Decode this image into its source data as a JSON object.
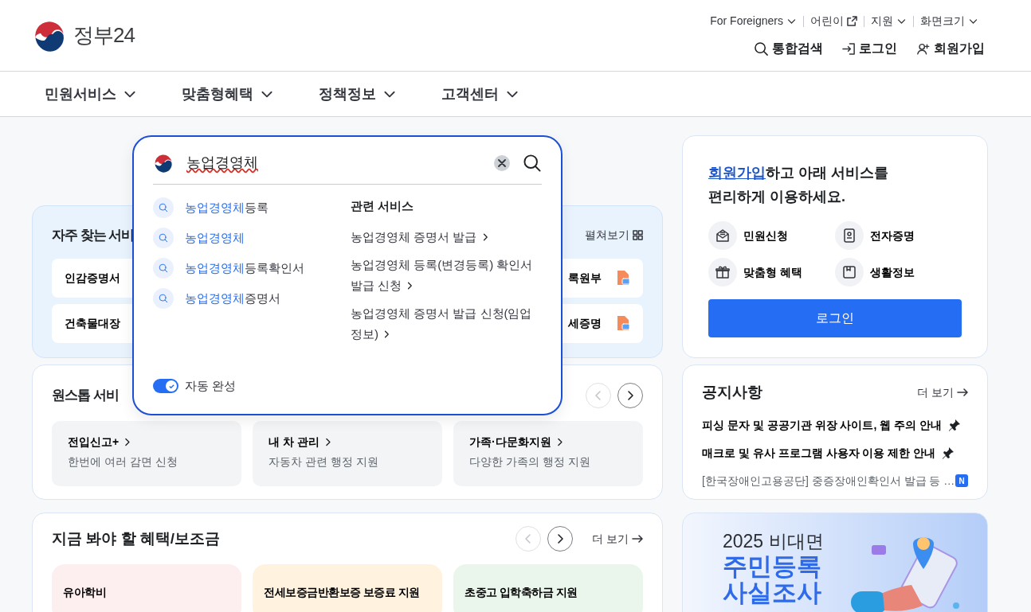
{
  "header": {
    "logo_text": "정부24",
    "top_links": [
      {
        "label": "For Foreigners",
        "kind": "chevron"
      },
      {
        "label": "어린이",
        "kind": "external"
      },
      {
        "label": "지원",
        "kind": "chevron"
      },
      {
        "label": "화면크기",
        "kind": "chevron"
      }
    ],
    "actions": [
      {
        "label": "통합검색",
        "kind": "search"
      },
      {
        "label": "로그인",
        "kind": "login"
      },
      {
        "label": "회원가입",
        "kind": "signup"
      }
    ]
  },
  "nav": [
    {
      "label": "민원서비스"
    },
    {
      "label": "맞춤형혜택"
    },
    {
      "label": "정책정보"
    },
    {
      "label": "고객센터"
    }
  ],
  "search_popup": {
    "query": "농업경영체",
    "suggestions": [
      {
        "match": "농업경영체",
        "rest": "등록"
      },
      {
        "match": "농업경영체"
      },
      {
        "match": "농업경영체",
        "rest": "등록확인서"
      },
      {
        "match": "농업경영체",
        "rest": "증명서"
      }
    ],
    "related_title": "관련 서비스",
    "related": [
      "농업경영체 증명서 발급",
      "농업경영체 등록(변경등록) 확인서 발급 신청",
      "농업경영체 증명서 발급 신청(임업 정보)"
    ],
    "autocomplete": {
      "label": "자동 완성",
      "on": true
    }
  },
  "frequent": {
    "title": "자주 찾는 서비",
    "expand_label": "펼쳐보기",
    "rows": [
      {
        "first": "인감증명서",
        "last": "록원부"
      },
      {
        "first": "건축물대장",
        "last": "세증명"
      }
    ]
  },
  "onestop": {
    "title": "원스톱 서비",
    "pager": [
      {
        "kind": "prev",
        "disabled": true
      },
      {
        "kind": "next",
        "disabled": false
      }
    ],
    "services": [
      {
        "title": "전입신고+",
        "description": "한번에 여러 감면 신청"
      },
      {
        "title": "내 차 관리",
        "description": "자동차 관련 행정 지원"
      },
      {
        "title": "가족·다문화지원",
        "description": "다양한 가족의 행정 지원"
      }
    ]
  },
  "benefits": {
    "title": "지금 봐야 할 혜택/보조금",
    "more": "더 보기",
    "pager": [
      {
        "kind": "prev",
        "disabled": true
      },
      {
        "kind": "next",
        "disabled": false
      }
    ],
    "items": [
      {
        "title": "유아학비",
        "color": "#fdeef0"
      },
      {
        "title": "전세보증금반환보증 보증료 지원",
        "color": "#fff3df"
      },
      {
        "title": "초중고 입학축하금 지원",
        "color": "#eaf5ec"
      }
    ]
  },
  "login_card": {
    "link": "회원가입",
    "text": "하고 아래 서비스를 편리하게 이용하세요.",
    "shortcuts": [
      {
        "label": "민원신청",
        "kind": "mail"
      },
      {
        "label": "전자증명",
        "kind": "id"
      },
      {
        "label": "맞춤형 혜택",
        "kind": "gift"
      },
      {
        "label": "생활정보",
        "kind": "book"
      }
    ],
    "button": "로그인"
  },
  "notice": {
    "title": "공지사항",
    "more": "더 보기",
    "items": [
      {
        "text": "피싱 문자 및 공공기관 위장 사이트, 웹 주의 안내",
        "kind": "pinned"
      },
      {
        "text": "매크로 및 유사 프로그램 사용자 이용 제한 안내",
        "kind": "pinned"
      },
      {
        "text": "[한국장애인고용공단] 중증장애인확인서 발급 등 …",
        "kind": "new",
        "badge": "N"
      }
    ]
  },
  "banner": {
    "lines": [
      "2025 비대면",
      "주민등록",
      "사실조사"
    ]
  }
}
